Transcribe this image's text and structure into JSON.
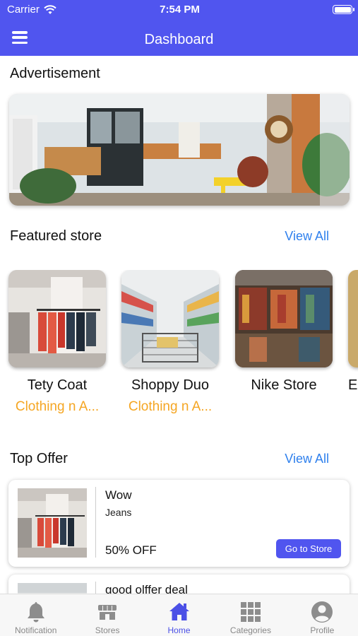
{
  "status_bar": {
    "carrier": "Carrier",
    "time": "7:54 PM"
  },
  "header": {
    "title": "Dashboard",
    "menu_icon": "hamburger-menu-icon"
  },
  "advertisement": {
    "title": "Advertisement"
  },
  "featured": {
    "title": "Featured store",
    "view_all": "View All",
    "stores": [
      {
        "name": "Tety Coat",
        "category": "Clothing n A..."
      },
      {
        "name": "Shoppy Duo",
        "category": "Clothing n A..."
      },
      {
        "name": "Nike Store",
        "category": ""
      },
      {
        "name": "E",
        "category": ""
      }
    ]
  },
  "top_offer": {
    "title": "Top Offer",
    "view_all": "View All",
    "offers": [
      {
        "title": "Wow",
        "subtitle": "Jeans",
        "discount": "50% OFF",
        "button": "Go to Store"
      },
      {
        "title": "good olffer deal",
        "subtitle": "",
        "discount": "",
        "button": ""
      }
    ]
  },
  "tabs": [
    {
      "label": "Notification",
      "icon": "bell-icon",
      "active": false
    },
    {
      "label": "Stores",
      "icon": "store-icon",
      "active": false
    },
    {
      "label": "Home",
      "icon": "home-icon",
      "active": true
    },
    {
      "label": "Categories",
      "icon": "grid-icon",
      "active": false
    },
    {
      "label": "Profile",
      "icon": "profile-icon",
      "active": false
    }
  ],
  "colors": {
    "brand": "#5055ef",
    "link": "#2f80ed",
    "category": "#f5a623",
    "tab_inactive": "#888888"
  }
}
